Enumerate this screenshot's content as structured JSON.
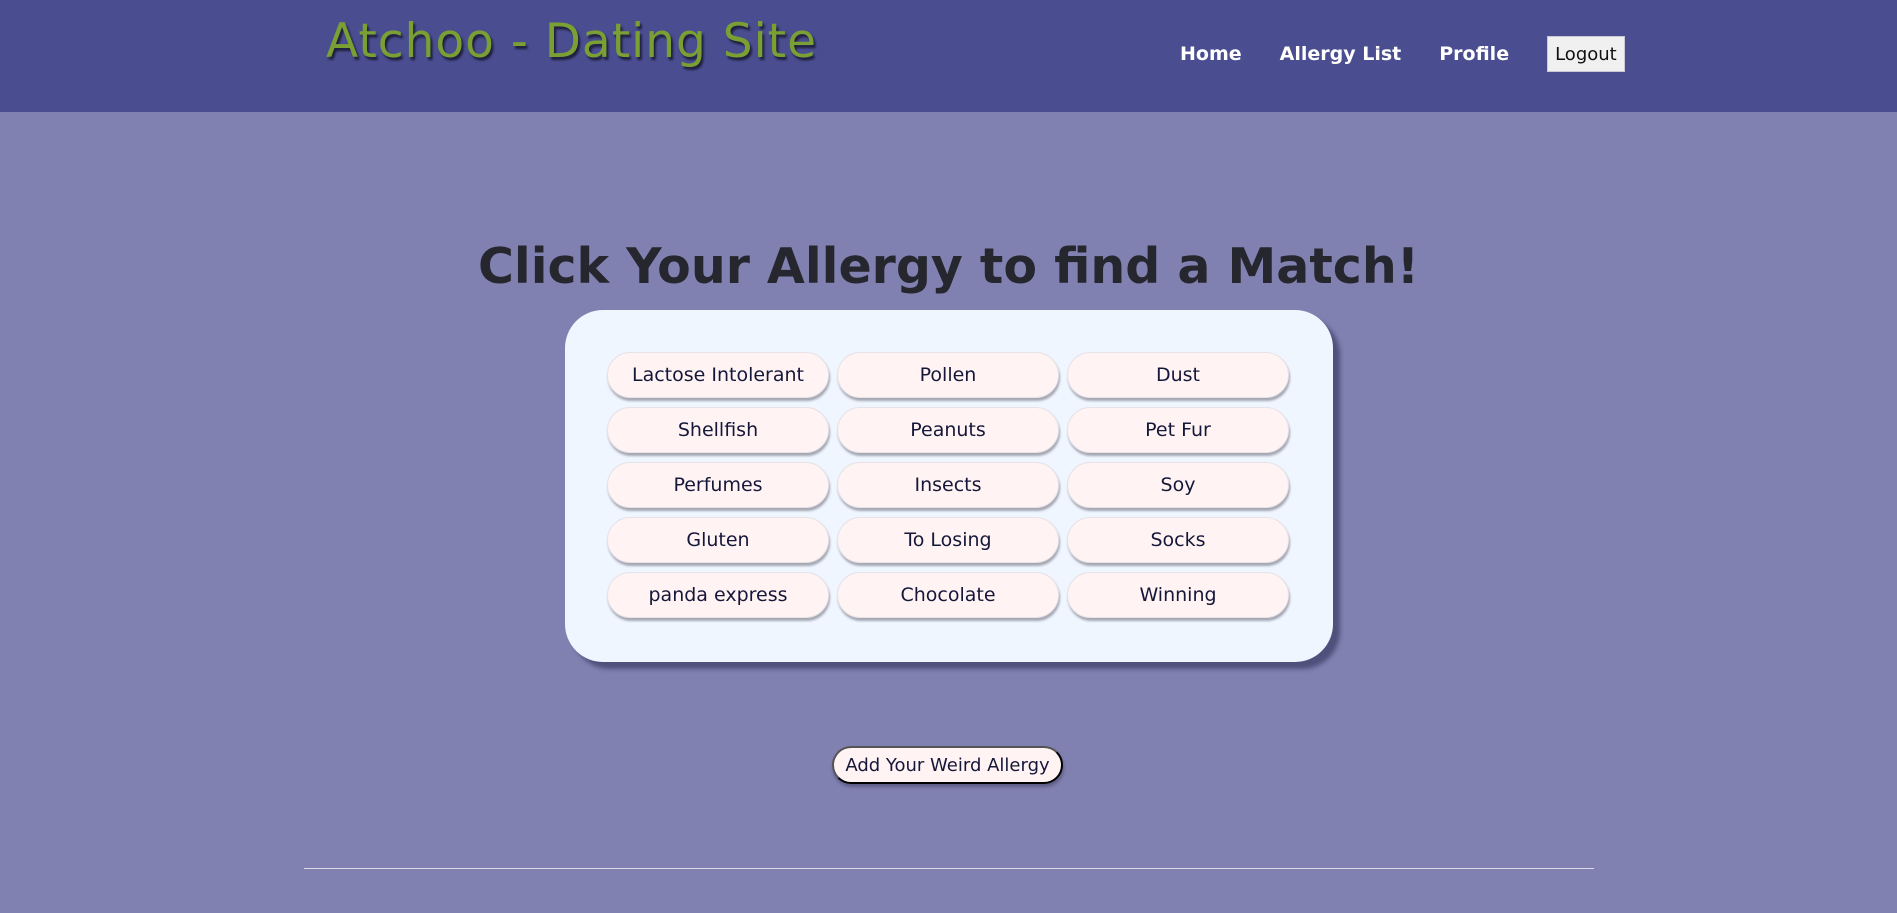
{
  "header": {
    "title": "Atchoo - Dating Site",
    "nav": [
      "Home",
      "Allergy List",
      "Profile"
    ],
    "logout_label": "Logout"
  },
  "main": {
    "heading": "Click Your Allergy to find a Match!",
    "allergies": [
      "Lactose Intolerant",
      "Pollen",
      "Dust",
      "Shellfish",
      "Peanuts",
      "Pet Fur",
      "Perfumes",
      "Insects",
      "Soy",
      "Gluten",
      "To Losing",
      "Socks",
      "panda express",
      "Chocolate",
      "Winning"
    ],
    "add_button_label": "Add Your Weird Allergy"
  },
  "colors": {
    "header_bg": "#4a4e91",
    "page_bg": "#8181b1",
    "title_green": "#7aa034",
    "card_bg": "#eff6ff",
    "pill_bg": "#fff4f3"
  }
}
